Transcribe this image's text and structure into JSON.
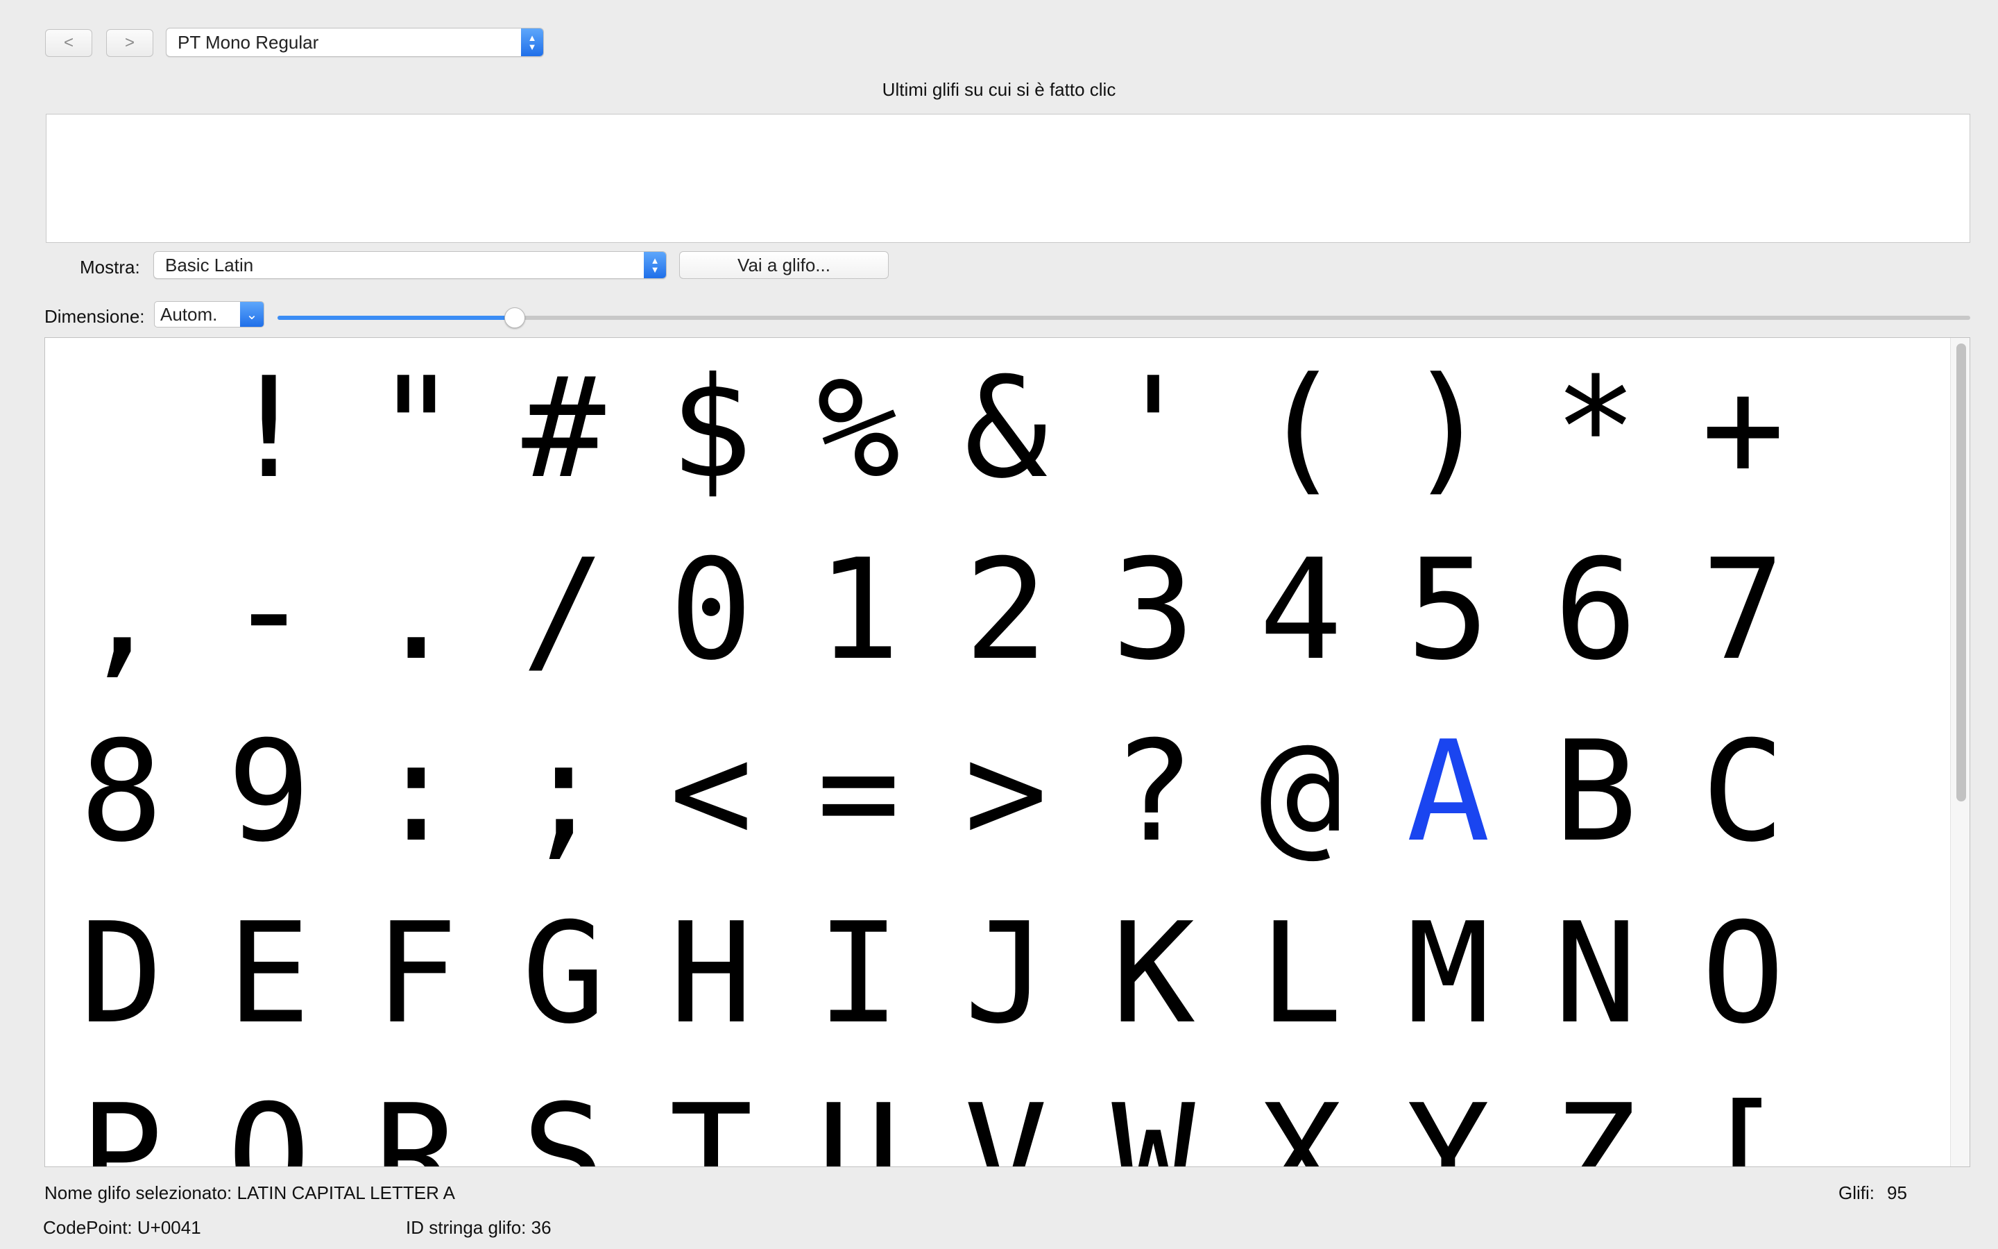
{
  "toolbar": {
    "back_label": "<",
    "forward_label": ">",
    "font_selected": "PT Mono Regular"
  },
  "recent": {
    "title": "Ultimi glifi su cui si è fatto clic"
  },
  "show": {
    "label": "Mostra:",
    "selected": "Basic Latin",
    "goto_label": "Vai a glifo..."
  },
  "size": {
    "label": "Dimensione:",
    "selected": "Autom.",
    "slider_value": 0.14
  },
  "glyphs": [
    " ",
    "!",
    "\"",
    "#",
    "$",
    "%",
    "&",
    "'",
    "(",
    ")",
    "*",
    "+",
    ",",
    "-",
    ".",
    "/",
    "0",
    "1",
    "2",
    "3",
    "4",
    "5",
    "6",
    "7",
    "8",
    "9",
    ":",
    ";",
    "<",
    "=",
    ">",
    "?",
    "@",
    "A",
    "B",
    "C",
    "D",
    "E",
    "F",
    "G",
    "H",
    "I",
    "J",
    "K",
    "L",
    "M",
    "N",
    "O",
    "P",
    "Q",
    "R",
    "S",
    "T",
    "U",
    "V",
    "W",
    "X",
    "Y",
    "Z",
    "["
  ],
  "selected_glyph": "A",
  "colors": {
    "accent": "#1f6fe9",
    "selected_glyph": "#1a45f0"
  },
  "status": {
    "glyph_name": "Nome glifo selezionato: LATIN CAPITAL LETTER A",
    "codepoint": "CodePoint: U+0041",
    "string_id": "ID stringa glifo: 36",
    "glyph_count_label": "Glifi:",
    "glyph_count": "95"
  }
}
